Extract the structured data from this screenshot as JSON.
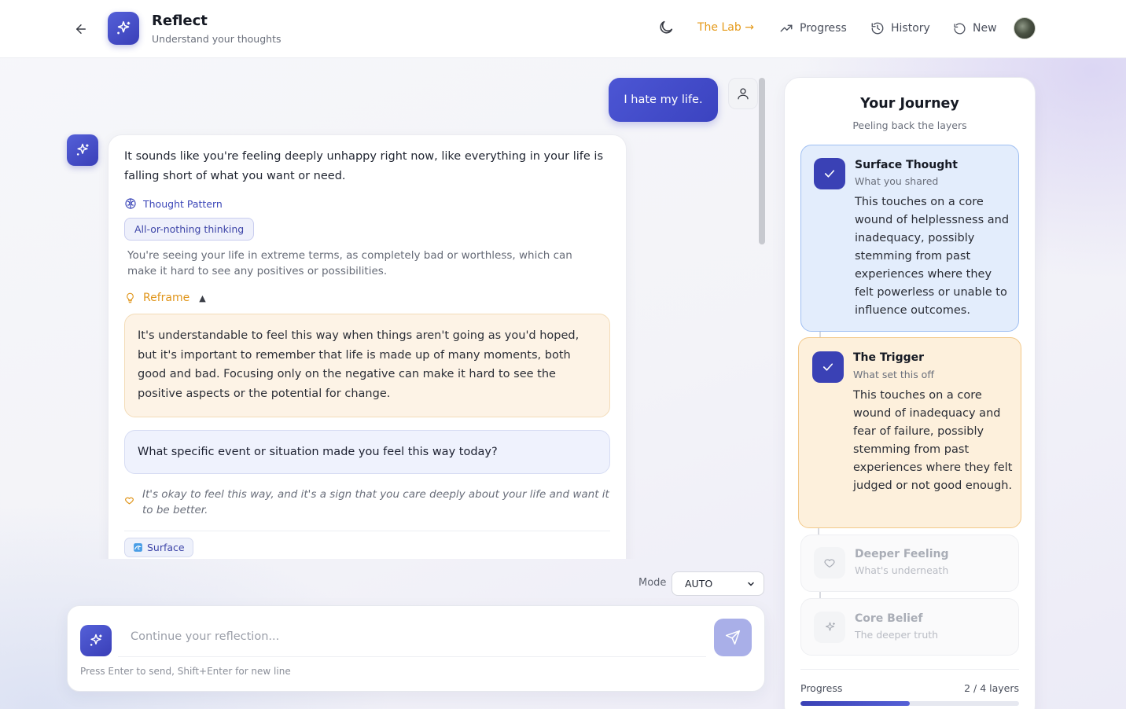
{
  "header": {
    "title": "Reflect",
    "subtitle": "Understand your thoughts",
    "nav": {
      "lab": "The Lab →",
      "progress": "Progress",
      "history": "History",
      "new": "New"
    }
  },
  "chat": {
    "user_message": "I hate my life.",
    "ai_message": "It sounds like you're feeling deeply unhappy right now, like everything in your life is falling short of what you want or need.",
    "thought_pattern_label": "Thought Pattern",
    "thought_pattern_tag": "All-or-nothing thinking",
    "thought_pattern_desc": "You're seeing your life in extreme terms, as completely bad or worthless, which can make it hard to see any positives or possibilities.",
    "reframe_label": "Reframe",
    "reframe_caret": "▲",
    "reframe_text": "It's understandable to feel this way when things aren't going as you'd hoped, but it's important to remember that life is made up of many moments, both good and bad. Focusing only on the negative can make it hard to see the positive aspects or the potential for change.",
    "question": "What specific event or situation made you feel this way today?",
    "comfort": "It's okay to feel this way, and it's a sign that you care deeply about your life and want it to be better.",
    "layer_tag": "Surface"
  },
  "composer": {
    "mode_label": "Mode",
    "mode_value": "AUTO",
    "placeholder": "Continue your reflection...",
    "hint": "Press Enter to send, Shift+Enter for new line"
  },
  "journey": {
    "title": "Your Journey",
    "subtitle": "Peeling back the layers",
    "steps": [
      {
        "title": "Surface Thought",
        "subtitle": "What you shared",
        "body": "This touches on a core wound of helplessness and inadequacy, possibly stemming from past experiences where they felt powerless or unable to influence outcomes.",
        "status": "complete"
      },
      {
        "title": "The Trigger",
        "subtitle": "What set this off",
        "body": "This touches on a core wound of inadequacy and fear of failure, possibly stemming from past experiences where they felt judged or not good enough.",
        "status": "complete"
      },
      {
        "title": "Deeper Feeling",
        "subtitle": "What's underneath",
        "status": "locked"
      },
      {
        "title": "Core Belief",
        "subtitle": "The deeper truth",
        "status": "locked"
      }
    ],
    "progress_label": "Progress",
    "progress_count": "2 / 4 layers",
    "progress_fraction": 0.5
  },
  "colors": {
    "accent": "#3a41b5",
    "reframe": "#e0951a",
    "surface_step_bg": "#e3edfc",
    "trigger_step_bg": "#fdf0dc"
  },
  "icons": {
    "back": "arrow-left-icon",
    "logo": "sparkles-icon",
    "theme": "moon-icon",
    "progress": "trending-up-icon",
    "history": "history-icon",
    "new": "refresh-icon",
    "user": "user-icon",
    "pattern": "brain-icon",
    "reframe": "lightbulb-icon",
    "comfort": "heart-icon",
    "surface": "wave-icon",
    "send": "send-icon",
    "check": "check-icon"
  }
}
